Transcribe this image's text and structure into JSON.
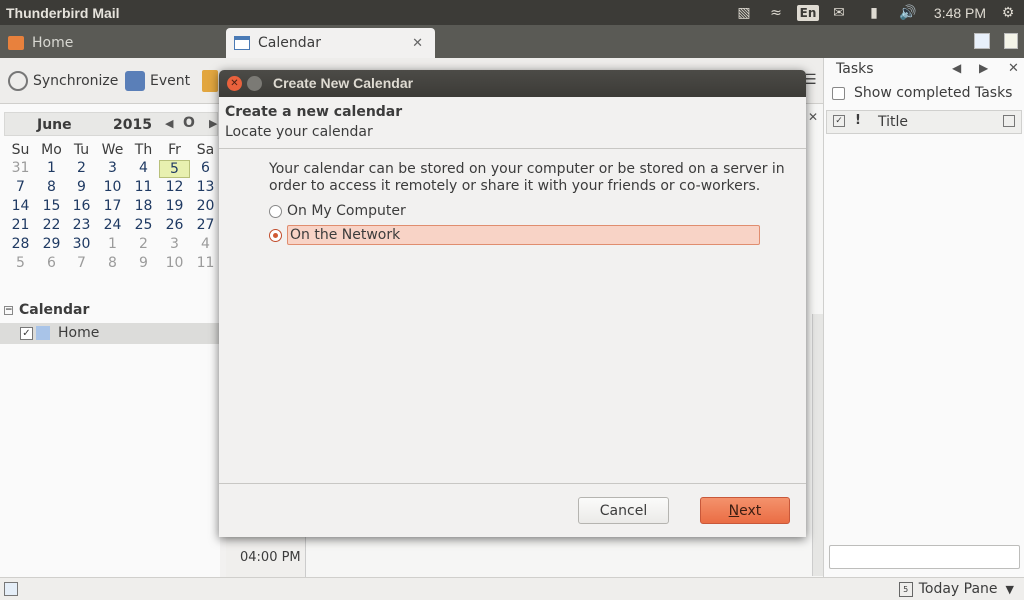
{
  "system": {
    "app_title": "Thunderbird Mail",
    "language": "En",
    "clock": "3:48 PM"
  },
  "tabs": [
    {
      "label": "Home"
    },
    {
      "label": "Calendar"
    }
  ],
  "toolbar": {
    "synchronize": "Synchronize",
    "event": "Event"
  },
  "minimonth": {
    "month": "June",
    "year": "2015",
    "today_btn": "O",
    "days_of_week": [
      "Su",
      "Mo",
      "Tu",
      "We",
      "Th",
      "Fr",
      "Sa"
    ],
    "weeks": [
      [
        "31",
        "1",
        "2",
        "3",
        "4",
        "5",
        "6"
      ],
      [
        "7",
        "8",
        "9",
        "10",
        "11",
        "12",
        "13"
      ],
      [
        "14",
        "15",
        "16",
        "17",
        "18",
        "19",
        "20"
      ],
      [
        "21",
        "22",
        "23",
        "24",
        "25",
        "26",
        "27"
      ],
      [
        "28",
        "29",
        "30",
        "1",
        "2",
        "3",
        "4"
      ],
      [
        "5",
        "6",
        "7",
        "8",
        "9",
        "10",
        "11"
      ]
    ],
    "today": "5"
  },
  "calendars": {
    "section_title": "Calendar",
    "items": [
      {
        "name": "Home",
        "checked": true,
        "color": "#a9c4e8"
      }
    ]
  },
  "center": {
    "time_label": "04:00 PM"
  },
  "tasks": {
    "title": "Tasks",
    "show_completed": "Show completed Tasks",
    "col_title": "Title"
  },
  "statusbar": {
    "today_pane": "Today Pane",
    "today_pane_day": "5"
  },
  "dialog": {
    "title": "Create New Calendar",
    "heading": "Create a new calendar",
    "subheading": "Locate your calendar",
    "description": "Your calendar can be stored on your computer or be stored on a server in order to access it remotely or share it with your friends or co-workers.",
    "options": [
      {
        "label": "On My Computer",
        "selected": false
      },
      {
        "label": "On the Network",
        "selected": true
      }
    ],
    "cancel": "Cancel",
    "next_accel": "N",
    "next_rest": "ext"
  },
  "colors": {
    "accent": "#ea6d44",
    "selection": "#f8d3c6",
    "panel": "#3c3b37"
  }
}
